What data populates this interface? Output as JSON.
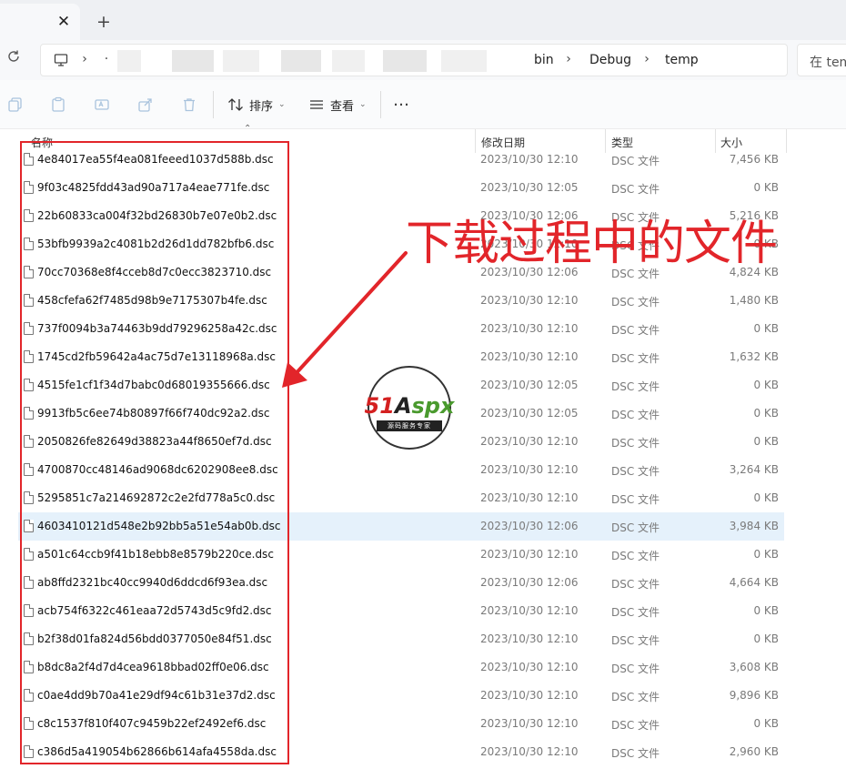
{
  "tabs": {
    "close_glyph": "✕",
    "new_glyph": "+"
  },
  "address": {
    "breadcrumbs": [
      "bin",
      "Debug",
      "temp"
    ],
    "search_text": "在 tem"
  },
  "toolbar": {
    "sort_label": "排序",
    "view_label": "查看",
    "more_glyph": "…"
  },
  "columns": {
    "name": "名称",
    "date": "修改日期",
    "type": "类型",
    "size": "大小"
  },
  "files": [
    {
      "name": "4e84017ea55f4ea081feeed1037d588b.dsc",
      "date": "2023/10/30 12:10",
      "type": "DSC 文件",
      "size": "7,456 KB"
    },
    {
      "name": "9f03c4825fdd43ad90a717a4eae771fe.dsc",
      "date": "2023/10/30 12:05",
      "type": "DSC 文件",
      "size": "0 KB"
    },
    {
      "name": "22b60833ca004f32bd26830b7e07e0b2.dsc",
      "date": "2023/10/30 12:06",
      "type": "DSC 文件",
      "size": "5,216 KB"
    },
    {
      "name": "53bfb9939a2c4081b2d26d1dd782bfb6.dsc",
      "date": "2023/10/30 12:10",
      "type": "DSC 文件",
      "size": "0 KB"
    },
    {
      "name": "70cc70368e8f4cceb8d7c0ecc3823710.dsc",
      "date": "2023/10/30 12:06",
      "type": "DSC 文件",
      "size": "4,824 KB"
    },
    {
      "name": "458cfefa62f7485d98b9e7175307b4fe.dsc",
      "date": "2023/10/30 12:10",
      "type": "DSC 文件",
      "size": "1,480 KB"
    },
    {
      "name": "737f0094b3a74463b9dd79296258a42c.dsc",
      "date": "2023/10/30 12:10",
      "type": "DSC 文件",
      "size": "0 KB"
    },
    {
      "name": "1745cd2fb59642a4ac75d7e13118968a.dsc",
      "date": "2023/10/30 12:10",
      "type": "DSC 文件",
      "size": "1,632 KB"
    },
    {
      "name": "4515fe1cf1f34d7babc0d68019355666.dsc",
      "date": "2023/10/30 12:05",
      "type": "DSC 文件",
      "size": "0 KB"
    },
    {
      "name": "9913fb5c6ee74b80897f66f740dc92a2.dsc",
      "date": "2023/10/30 12:05",
      "type": "DSC 文件",
      "size": "0 KB"
    },
    {
      "name": "2050826fe82649d38823a44f8650ef7d.dsc",
      "date": "2023/10/30 12:10",
      "type": "DSC 文件",
      "size": "0 KB"
    },
    {
      "name": "4700870cc48146ad9068dc6202908ee8.dsc",
      "date": "2023/10/30 12:10",
      "type": "DSC 文件",
      "size": "3,264 KB"
    },
    {
      "name": "5295851c7a214692872c2e2fd778a5c0.dsc",
      "date": "2023/10/30 12:10",
      "type": "DSC 文件",
      "size": "0 KB"
    },
    {
      "name": "4603410121d548e2b92bb5a51e54ab0b.dsc",
      "date": "2023/10/30 12:06",
      "type": "DSC 文件",
      "size": "3,984 KB",
      "selected": true
    },
    {
      "name": "a501c64ccb9f41b18ebb8e8579b220ce.dsc",
      "date": "2023/10/30 12:10",
      "type": "DSC 文件",
      "size": "0 KB"
    },
    {
      "name": "ab8ffd2321bc40cc9940d6ddcd6f93ea.dsc",
      "date": "2023/10/30 12:06",
      "type": "DSC 文件",
      "size": "4,664 KB"
    },
    {
      "name": "acb754f6322c461eaa72d5743d5c9fd2.dsc",
      "date": "2023/10/30 12:10",
      "type": "DSC 文件",
      "size": "0 KB"
    },
    {
      "name": "b2f38d01fa824d56bdd0377050e84f51.dsc",
      "date": "2023/10/30 12:10",
      "type": "DSC 文件",
      "size": "0 KB"
    },
    {
      "name": "b8dc8a2f4d7d4cea9618bbad02ff0e06.dsc",
      "date": "2023/10/30 12:10",
      "type": "DSC 文件",
      "size": "3,608 KB"
    },
    {
      "name": "c0ae4dd9b70a41e29df94c61b31e37d2.dsc",
      "date": "2023/10/30 12:10",
      "type": "DSC 文件",
      "size": "9,896 KB"
    },
    {
      "name": "c8c1537f810f407c9459b22ef2492ef6.dsc",
      "date": "2023/10/30 12:10",
      "type": "DSC 文件",
      "size": "0 KB"
    },
    {
      "name": "c386d5a419054b62866b614afa4558da.dsc",
      "date": "2023/10/30 12:10",
      "type": "DSC 文件",
      "size": "2,960 KB"
    }
  ],
  "annotation": {
    "text": "下载过程中的文件",
    "color": "#e2252a"
  },
  "watermark": {
    "brand_a": "51",
    "brand_b": "A",
    "brand_c": "spx",
    "tagline": "源码服务专家"
  },
  "colors": {
    "accent": "#e2252a",
    "selected_row": "#e5f1fb"
  }
}
